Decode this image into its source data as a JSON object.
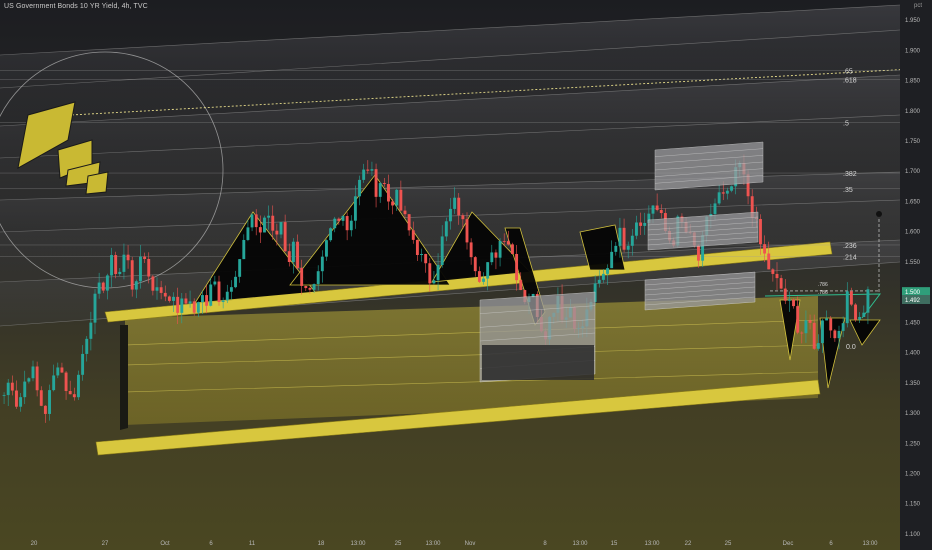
{
  "header": {
    "title": "US Government Bonds 10 YR Yield, 4h, TVC",
    "unit": "pct"
  },
  "colors": {
    "background_top": "#1c1d21",
    "background_bottom": "#4a4722",
    "up_candle": "#26a69a",
    "down_candle": "#ef5350",
    "channel_yellow": "#d8c73e",
    "fib_line": "#9a9a9a"
  },
  "chart_data": {
    "type": "candlestick",
    "symbol": "US Government Bonds 10 YR Yield",
    "timeframe": "4h",
    "source": "TVC",
    "y_axis": {
      "ticks": [
        "1.950",
        "1.900",
        "1.850",
        "1.800",
        "1.750",
        "1.700",
        "1.650",
        "1.600",
        "1.550",
        "1.500",
        "1.450",
        "1.400",
        "1.350",
        "1.300",
        "1.250",
        "1.200",
        "1.150",
        "1.100"
      ],
      "ylim": [
        1.09,
        1.97
      ],
      "current_price_labels": [
        "1.500",
        "1.492"
      ]
    },
    "x_axis": {
      "ticks": [
        "20",
        "27",
        "Oct",
        "6",
        "11",
        "18",
        "13:00",
        "25",
        "13:00",
        "Nov",
        "8",
        "13:00",
        "15",
        "13:00",
        "22",
        "25",
        "Dec",
        "6",
        "13:00"
      ]
    },
    "fib_levels": [
      {
        "label": ".65",
        "value": 1.867
      },
      {
        "label": ".618",
        "value": 1.852
      },
      {
        "label": ".5",
        "value": 1.781
      },
      {
        "label": ".382",
        "value": 1.697
      },
      {
        "label": ".35",
        "value": 1.671
      },
      {
        "label": ".236",
        "value": 1.578
      },
      {
        "label": ".214",
        "value": 1.559
      },
      {
        "label": ".786",
        "value": 1.51
      },
      {
        "label": ".786",
        "value": 1.502
      },
      {
        "label": "0.0",
        "value": 1.411
      }
    ],
    "price_path": [
      1.33,
      1.36,
      1.31,
      1.35,
      1.38,
      1.33,
      1.3,
      1.34,
      1.39,
      1.35,
      1.32,
      1.36,
      1.42,
      1.47,
      1.5,
      1.52,
      1.55,
      1.53,
      1.57,
      1.51,
      1.54,
      1.56,
      1.5,
      1.52,
      1.48,
      1.5,
      1.47,
      1.49,
      1.46,
      1.5,
      1.48,
      1.52,
      1.49,
      1.5,
      1.53,
      1.56,
      1.6,
      1.62,
      1.6,
      1.64,
      1.58,
      1.62,
      1.55,
      1.58,
      1.52,
      1.49,
      1.5,
      1.54,
      1.59,
      1.62,
      1.64,
      1.6,
      1.66,
      1.69,
      1.71,
      1.67,
      1.69,
      1.65,
      1.66,
      1.63,
      1.6,
      1.58,
      1.55,
      1.52,
      1.54,
      1.59,
      1.63,
      1.65,
      1.61,
      1.58,
      1.54,
      1.52,
      1.55,
      1.57,
      1.6,
      1.58,
      1.53,
      1.49,
      1.5,
      1.47,
      1.43,
      1.46,
      1.5,
      1.45,
      1.48,
      1.43,
      1.45,
      1.49,
      1.51,
      1.53,
      1.57,
      1.6,
      1.58,
      1.6,
      1.63,
      1.61,
      1.65,
      1.63,
      1.6,
      1.58,
      1.62,
      1.6,
      1.58,
      1.55,
      1.61,
      1.64,
      1.66,
      1.65,
      1.68,
      1.71,
      1.67,
      1.63,
      1.58,
      1.55,
      1.52,
      1.51,
      1.48,
      1.47,
      1.43,
      1.46,
      1.4,
      1.44,
      1.47,
      1.42,
      1.45,
      1.49,
      1.47,
      1.46,
      1.5
    ]
  }
}
